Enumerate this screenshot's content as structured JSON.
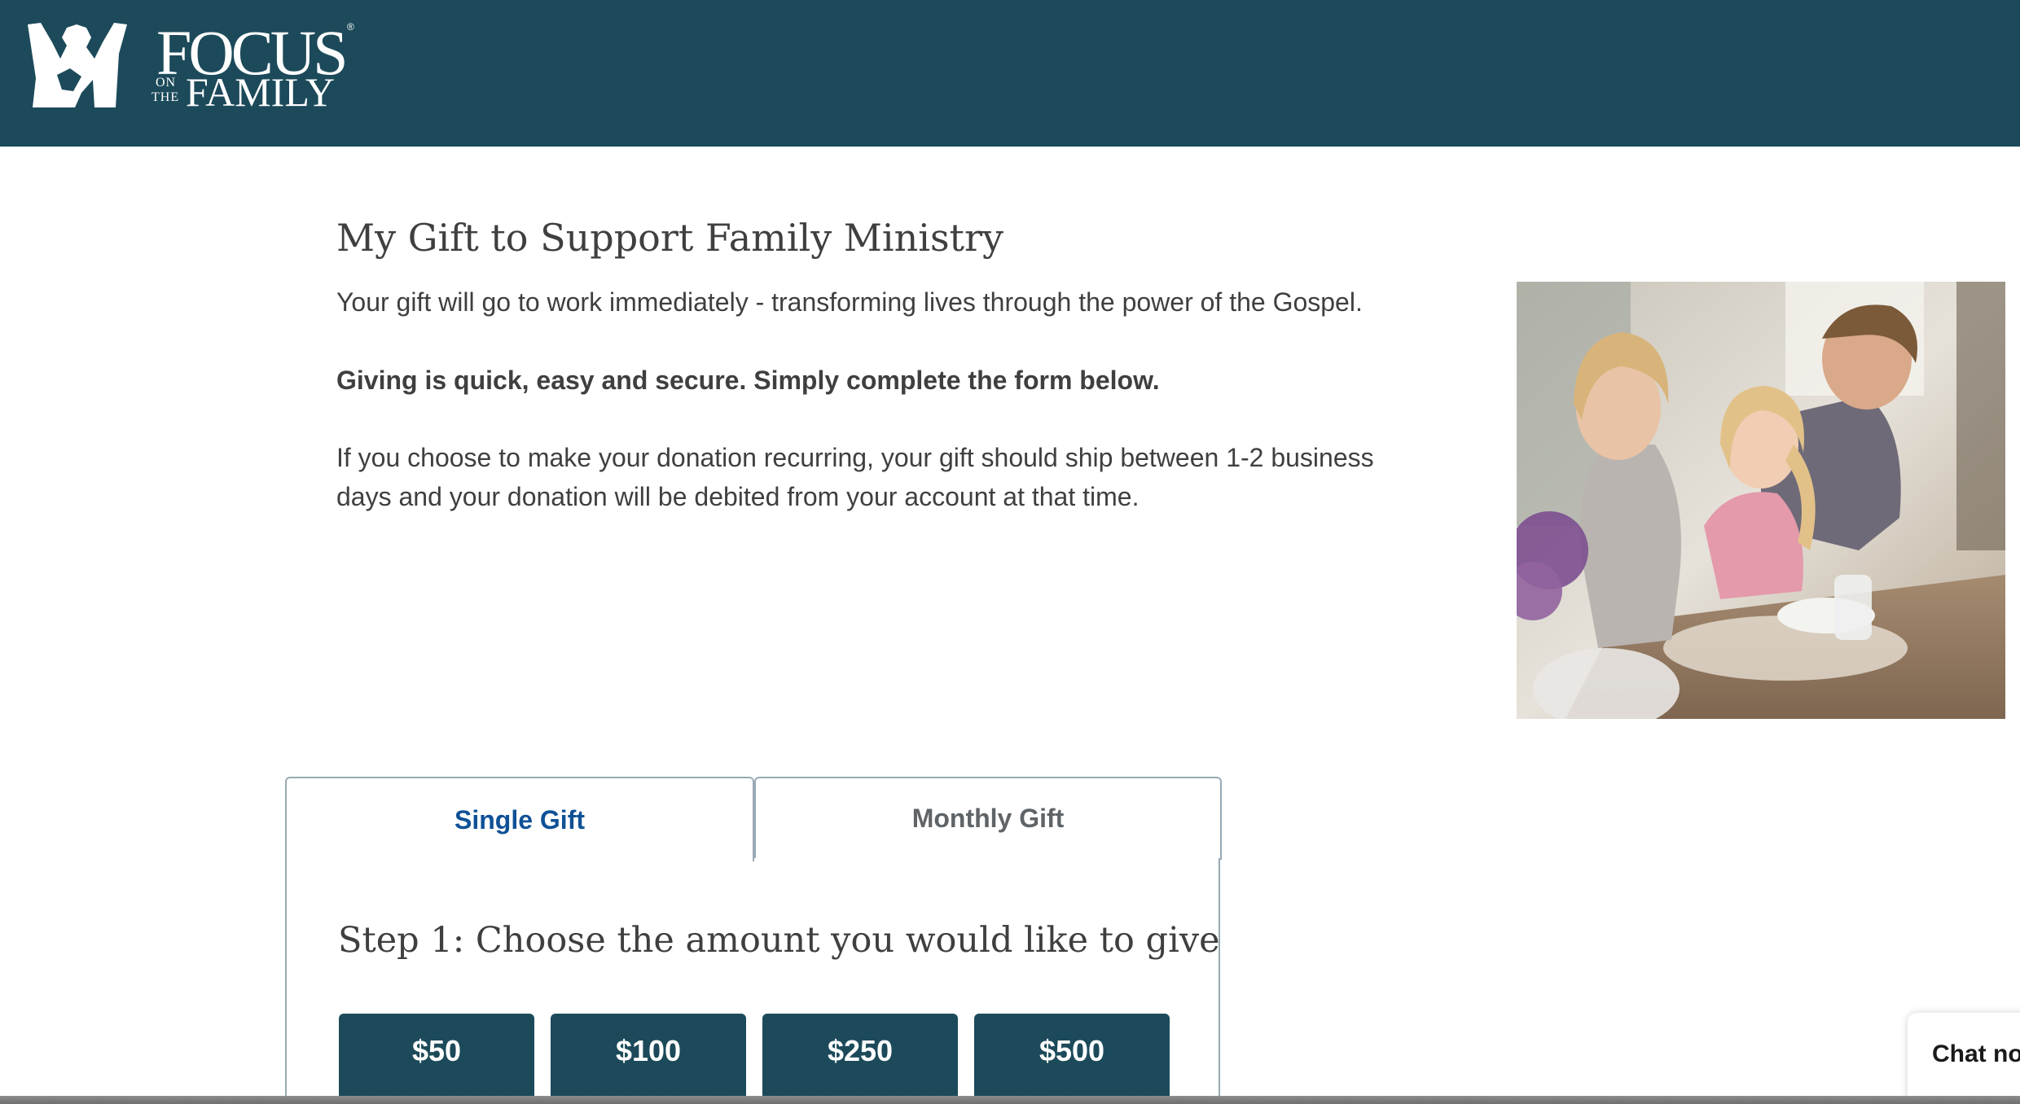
{
  "header": {
    "background_color": "#1c4a5a",
    "logo": {
      "word_top": "FOCUS",
      "registered": "®",
      "small_on": "ON",
      "small_the": "THE",
      "word_bottom": "FAMILY"
    }
  },
  "intro": {
    "title": "My Gift to Support Family Ministry",
    "paragraph_1": "Your gift will go to work immediately - transforming lives through the power of the Gospel.",
    "paragraph_2": "Giving is quick, easy and secure. Simply complete the form below.",
    "paragraph_3": "If you choose to make your donation recurring, your gift should ship between 1-2 business days and your donation will be debited from your account at that time."
  },
  "photo": {
    "icon": "family-baking-photo"
  },
  "gift_form": {
    "tabs": [
      {
        "label": "Single Gift",
        "selected": true
      },
      {
        "label": "Monthly Gift",
        "selected": false
      }
    ],
    "step_title": "Step 1: Choose the amount you would like to give",
    "amounts": [
      "$50",
      "$100",
      "$250",
      "$500"
    ],
    "button_color": "#1c4a5a",
    "active_tab_color": "#0f5196"
  },
  "chat": {
    "label": "Chat no"
  }
}
